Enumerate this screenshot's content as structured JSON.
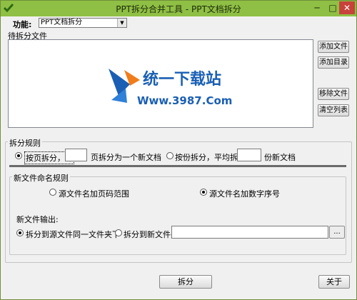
{
  "window": {
    "title": "PPT拆分合并工具 - PPT文档拆分",
    "minimize_glyph": "─",
    "maximize_glyph": "□",
    "close_glyph": "✕",
    "icon": "green-check-icon"
  },
  "toolbar": {
    "function_label": "功能:",
    "function_value": "PPT文档拆分"
  },
  "files": {
    "section_label": "待拆分文件",
    "watermark_title": "统一下载站",
    "watermark_url": "Www.3987.Com",
    "buttons": {
      "add_file": "添加文件",
      "add_dir": "添加目录",
      "remove_file": "移除文件",
      "clear_list": "清空列表"
    }
  },
  "split_rule": {
    "label": "拆分规则",
    "by_page_label": "按页拆分，每",
    "by_page_suffix": "页拆分为一个新文档",
    "by_page_value": "",
    "by_copies_label": "按份拆分，平均拆分为",
    "by_copies_suffix": "份新文档",
    "by_copies_value": "",
    "selected": "by_page"
  },
  "naming": {
    "label": "新文件命名规则",
    "option_page_range": "源文件名加页码范围",
    "option_number": "源文件名加数字序号",
    "selected": "number"
  },
  "output": {
    "label": "新文件输出:",
    "option_same_folder": "拆分到源文件同一文件夹下",
    "option_new_folder": "拆分到新文件夹:",
    "folder_path": "",
    "browse_label": "...",
    "selected": "same_folder"
  },
  "actions": {
    "split": "拆分",
    "about": "关于"
  },
  "colors": {
    "titlebar": "#8fbf45",
    "close": "#c7423a",
    "logo_blue": "#1a5fb4",
    "logo_orange": "#f07d1a"
  }
}
